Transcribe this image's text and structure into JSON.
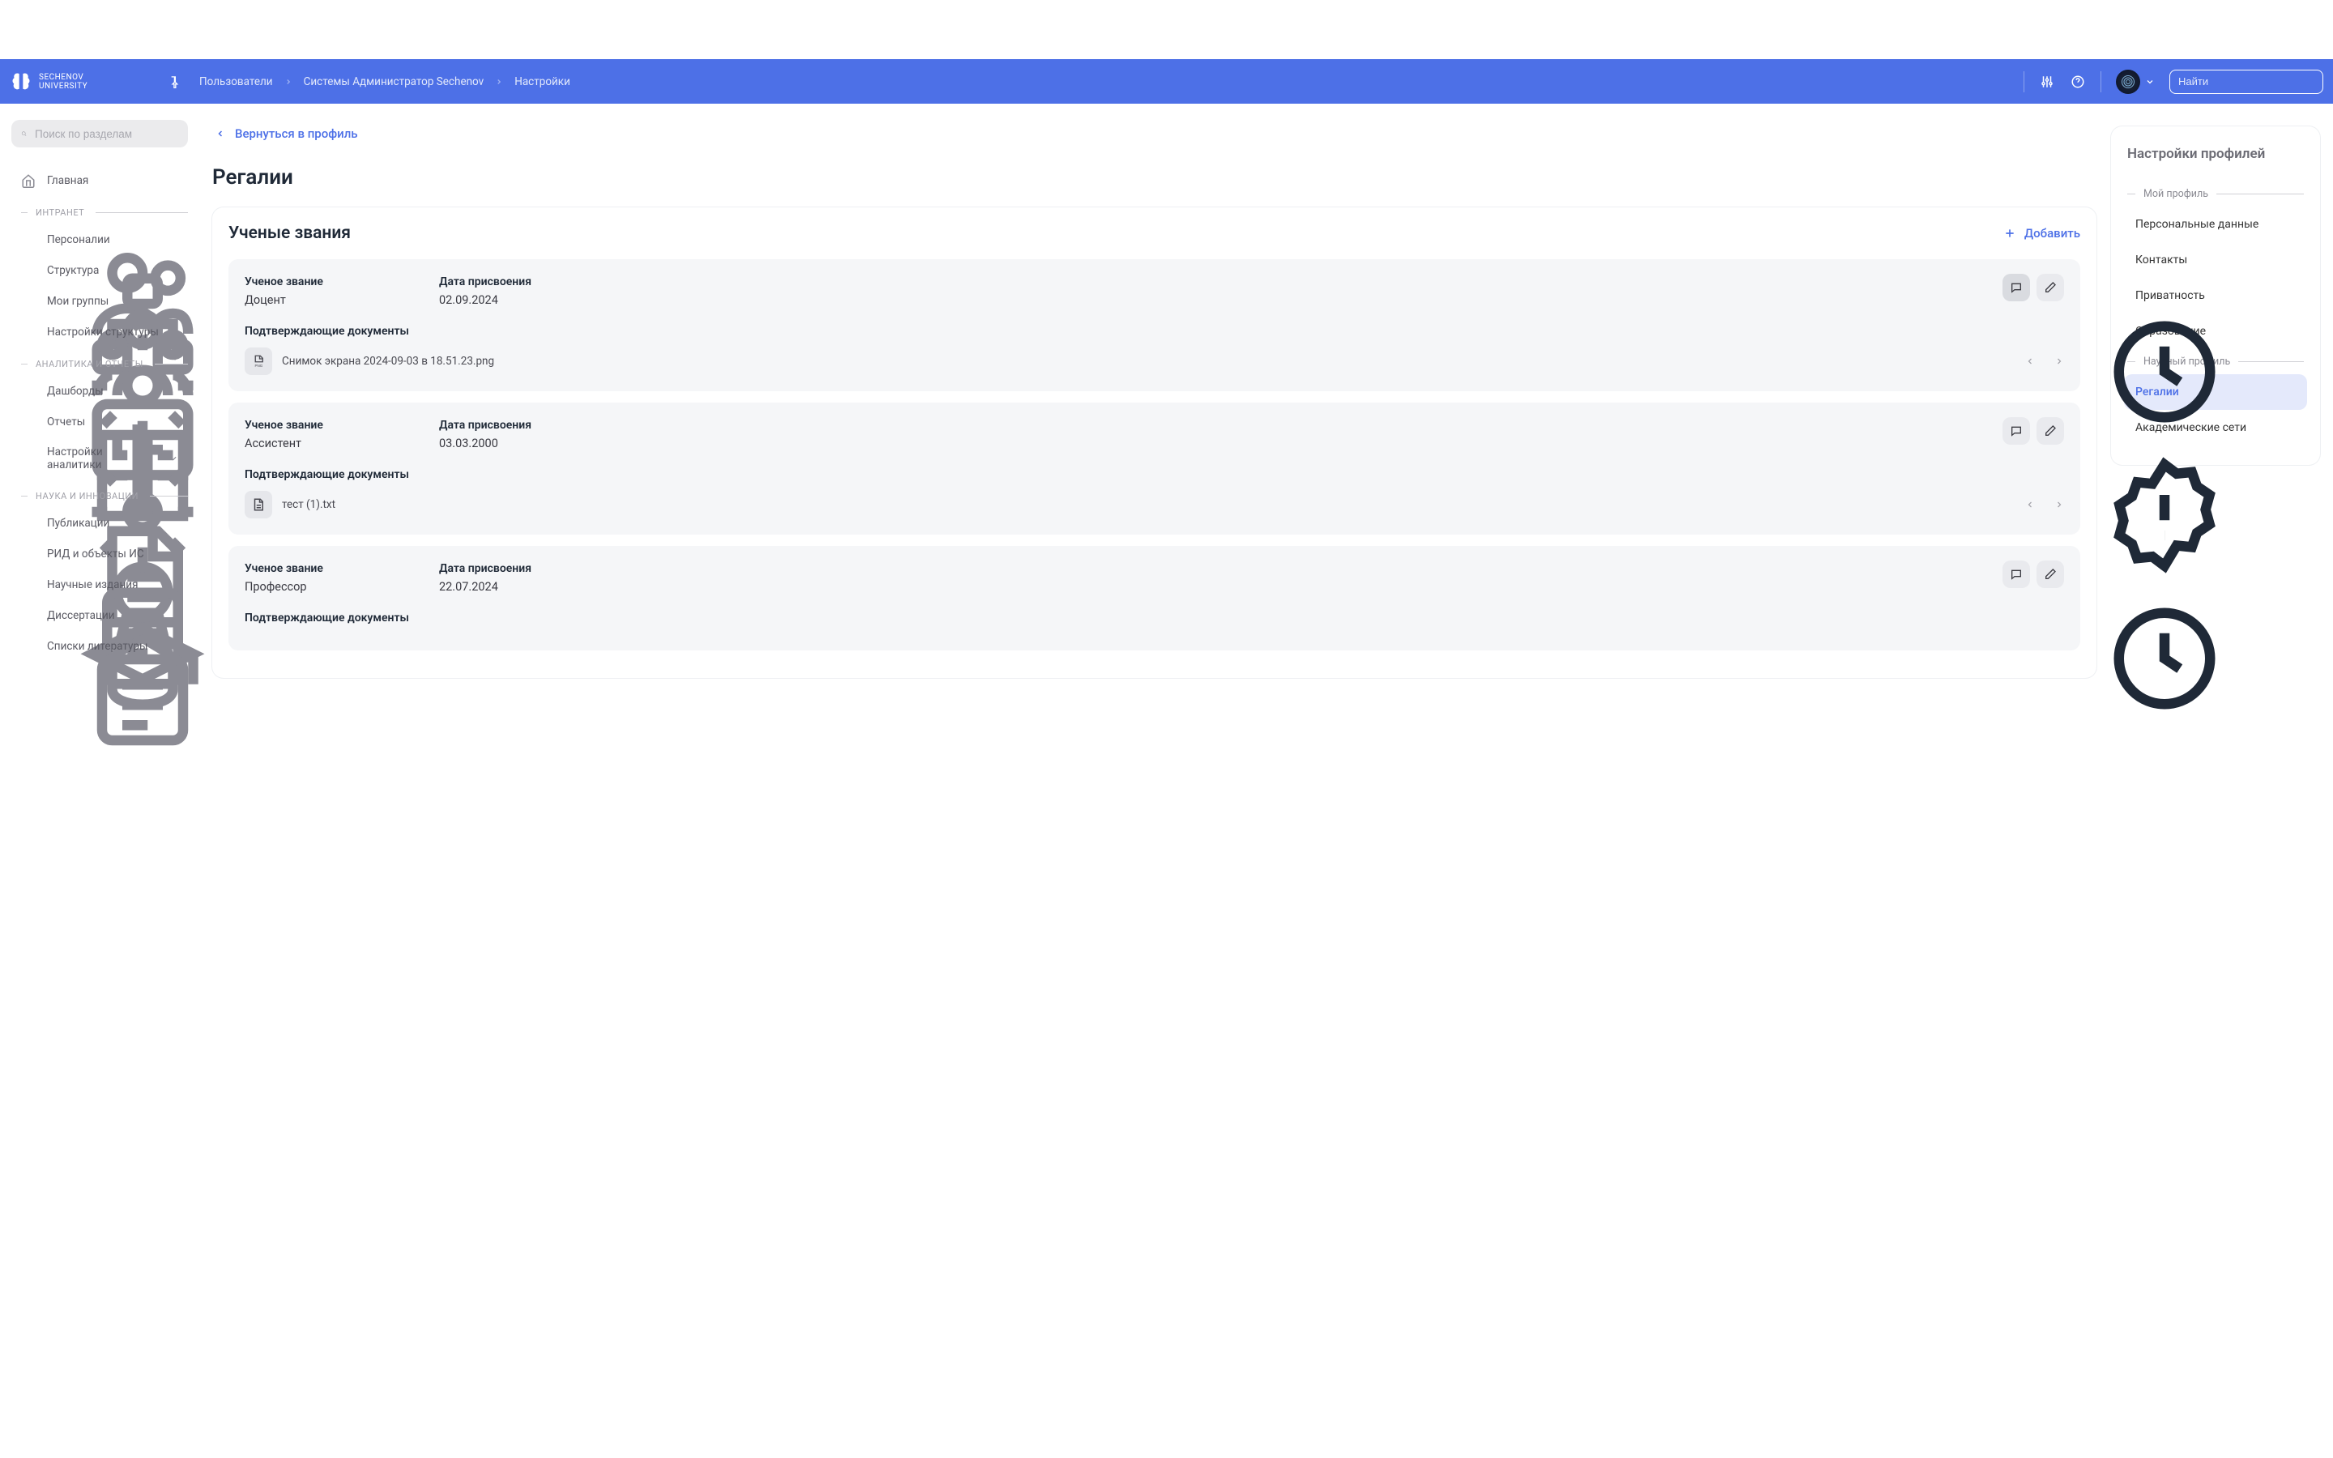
{
  "colors": {
    "accent": "#4d70e7"
  },
  "header": {
    "logo_line1": "SECHENOV",
    "logo_line2": "UNIVERSITY",
    "breadcrumb": [
      "Пользователи",
      "Системы Администратор Sechenov",
      "Настройки"
    ],
    "search_placeholder": "Найти"
  },
  "sidebar": {
    "search_placeholder": "Поиск по разделам",
    "items": [
      {
        "label": "Главная",
        "icon": "home-icon"
      }
    ],
    "sections": [
      {
        "title": "ИНТРАНЕТ",
        "items": [
          {
            "label": "Персоналии",
            "icon": "people-icon"
          },
          {
            "label": "Структура",
            "icon": "tree-icon"
          },
          {
            "label": "Мои группы",
            "icon": "groups-icon"
          },
          {
            "label": "Настройки структуры",
            "icon": "gear-icon"
          }
        ]
      },
      {
        "title": "АНАЛИТИКА И ОТЧЕТЫ",
        "items": [
          {
            "label": "Дашборды",
            "icon": "dashboard-icon"
          },
          {
            "label": "Отчеты",
            "icon": "report-icon"
          },
          {
            "label": "Настройки аналитики",
            "icon": "gear-icon",
            "expandable": true
          }
        ]
      },
      {
        "title": "НАУКА И ИННОВАЦИИ",
        "items": [
          {
            "label": "Публикации",
            "icon": "document-icon"
          },
          {
            "label": "РИД и объекты ИС",
            "icon": "award-icon"
          },
          {
            "label": "Научные издания",
            "icon": "journal-icon"
          },
          {
            "label": "Диссертации",
            "icon": "cap-icon"
          },
          {
            "label": "Списки литературы",
            "icon": "list-icon"
          }
        ]
      }
    ]
  },
  "main": {
    "back_label": "Вернуться в профиль",
    "page_title": "Регалии",
    "section_title": "Ученые звания",
    "add_label": "Добавить",
    "title_label": "Ученое звание",
    "date_label": "Дата присвоения",
    "docs_label": "Подтверждающие документы",
    "titles": [
      {
        "value": "Доцент",
        "date": "02.09.2024",
        "status": "clock",
        "comment_active": true,
        "docs": [
          {
            "name": "Снимок экрана 2024-09-03 в 18.51.23.png",
            "type": "png"
          }
        ]
      },
      {
        "value": "Ассистент",
        "date": "03.03.2000",
        "status": "badge",
        "docs": [
          {
            "name": "тест (1).txt",
            "type": "txt"
          }
        ]
      },
      {
        "value": "Профессор",
        "date": "22.07.2024",
        "status": "clock",
        "docs": []
      }
    ]
  },
  "settings_panel": {
    "title": "Настройки профилей",
    "groups": [
      {
        "title": "Мой профиль",
        "items": [
          {
            "label": "Персональные данные"
          },
          {
            "label": "Контакты"
          },
          {
            "label": "Приватность"
          },
          {
            "label": "Образование"
          }
        ]
      },
      {
        "title": "Научный профиль",
        "items": [
          {
            "label": "Регалии",
            "active": true
          },
          {
            "label": "Академические сети"
          }
        ]
      }
    ]
  }
}
